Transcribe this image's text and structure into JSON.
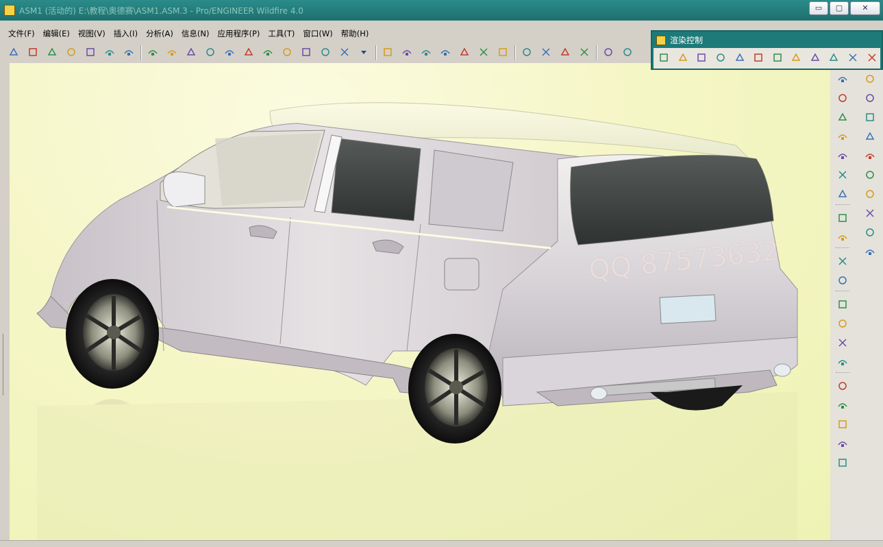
{
  "window": {
    "title": "ASM1 (活动的) E:\\教程\\奥德赛\\ASM1.ASM.3 - Pro/ENGINEER Wildfire 4.0",
    "min_label": "▭",
    "max_label": "▢",
    "close_label": "✕"
  },
  "menu": [
    {
      "label": "文件(F)"
    },
    {
      "label": "编辑(E)"
    },
    {
      "label": "视图(V)"
    },
    {
      "label": "插入(I)"
    },
    {
      "label": "分析(A)"
    },
    {
      "label": "信息(N)"
    },
    {
      "label": "应用程序(P)"
    },
    {
      "label": "工具(T)"
    },
    {
      "label": "窗口(W)"
    },
    {
      "label": "帮助(H)"
    }
  ],
  "toolbar": [
    {
      "icon": "new-file-icon"
    },
    {
      "icon": "open-folder-icon"
    },
    {
      "icon": "save-icon"
    },
    {
      "icon": "print-icon"
    },
    {
      "icon": "send-mail-icon"
    },
    {
      "icon": "mail-attach-icon"
    },
    {
      "icon": "close-window-icon"
    },
    {
      "sep": true
    },
    {
      "icon": "regenerate-icon"
    },
    {
      "icon": "undo-icon"
    },
    {
      "icon": "redo-icon"
    },
    {
      "icon": "cut-icon"
    },
    {
      "icon": "copy-icon"
    },
    {
      "icon": "paste-icon"
    },
    {
      "icon": "paste-special-icon"
    },
    {
      "icon": "regenerate-model-icon"
    },
    {
      "icon": "regen-manager-icon"
    },
    {
      "icon": "find-icon"
    },
    {
      "icon": "select-box-icon"
    },
    {
      "icon": "dropdown-arrow-icon"
    },
    {
      "sep": true
    },
    {
      "icon": "redraw-icon"
    },
    {
      "icon": "spin-center-icon"
    },
    {
      "icon": "orient-mode-icon"
    },
    {
      "icon": "zoom-in-icon"
    },
    {
      "icon": "layers-icon"
    },
    {
      "icon": "view-manager-icon"
    },
    {
      "icon": "appearance-icon"
    },
    {
      "sep": true
    },
    {
      "icon": "wireframe-icon"
    },
    {
      "icon": "hidden-line-icon"
    },
    {
      "icon": "no-hidden-icon"
    },
    {
      "icon": "shading-icon"
    },
    {
      "sep": true
    },
    {
      "icon": "datum-planes-icon"
    },
    {
      "icon": "datum-axes-icon"
    }
  ],
  "render_panel": {
    "title": "渲染控制",
    "tools": [
      "open-scene-icon",
      "scene-icon",
      "room-icon",
      "edit-appearance-icon",
      "color-wheel-icon",
      "environment-icon",
      "texture-icon",
      "lights-icon",
      "effects-icon",
      "render-globe-icon",
      "render-region-icon",
      "render-window-icon"
    ]
  },
  "palette": {
    "left": [
      "datum-plane-tool-icon",
      "datum-plane-2-icon",
      "datum-axis-icon",
      "datum-curve-icon",
      "datum-point-icon",
      "datum-csys-icon",
      "analysis-feature-icon",
      "dots",
      "insert-component-icon",
      "mirror-tool-icon",
      "dots",
      "assemble-icon",
      "create-part-icon",
      "dots",
      "extrude-tool-icon",
      "revolve-tool-icon",
      "sweep-tool-icon",
      "blend-tool-icon",
      "dots",
      "shell-tool-icon",
      "round-tool-icon",
      "draft-tool-icon",
      "rib-tool-icon",
      "boundary-blend-icon"
    ],
    "right": [
      "mirror-icon",
      "copy-geom-icon",
      "hole-tool-icon",
      "pattern-icon",
      "sketch-tool-icon",
      "style-tool-icon",
      "offset-icon",
      "trim-icon",
      "intersect-icon",
      "merge-icon"
    ]
  },
  "model": {
    "watermark": "QQ  87573632"
  },
  "colors": {
    "title_bar": "#1f6f6e",
    "viewport_bg": "#f5f6c6"
  }
}
